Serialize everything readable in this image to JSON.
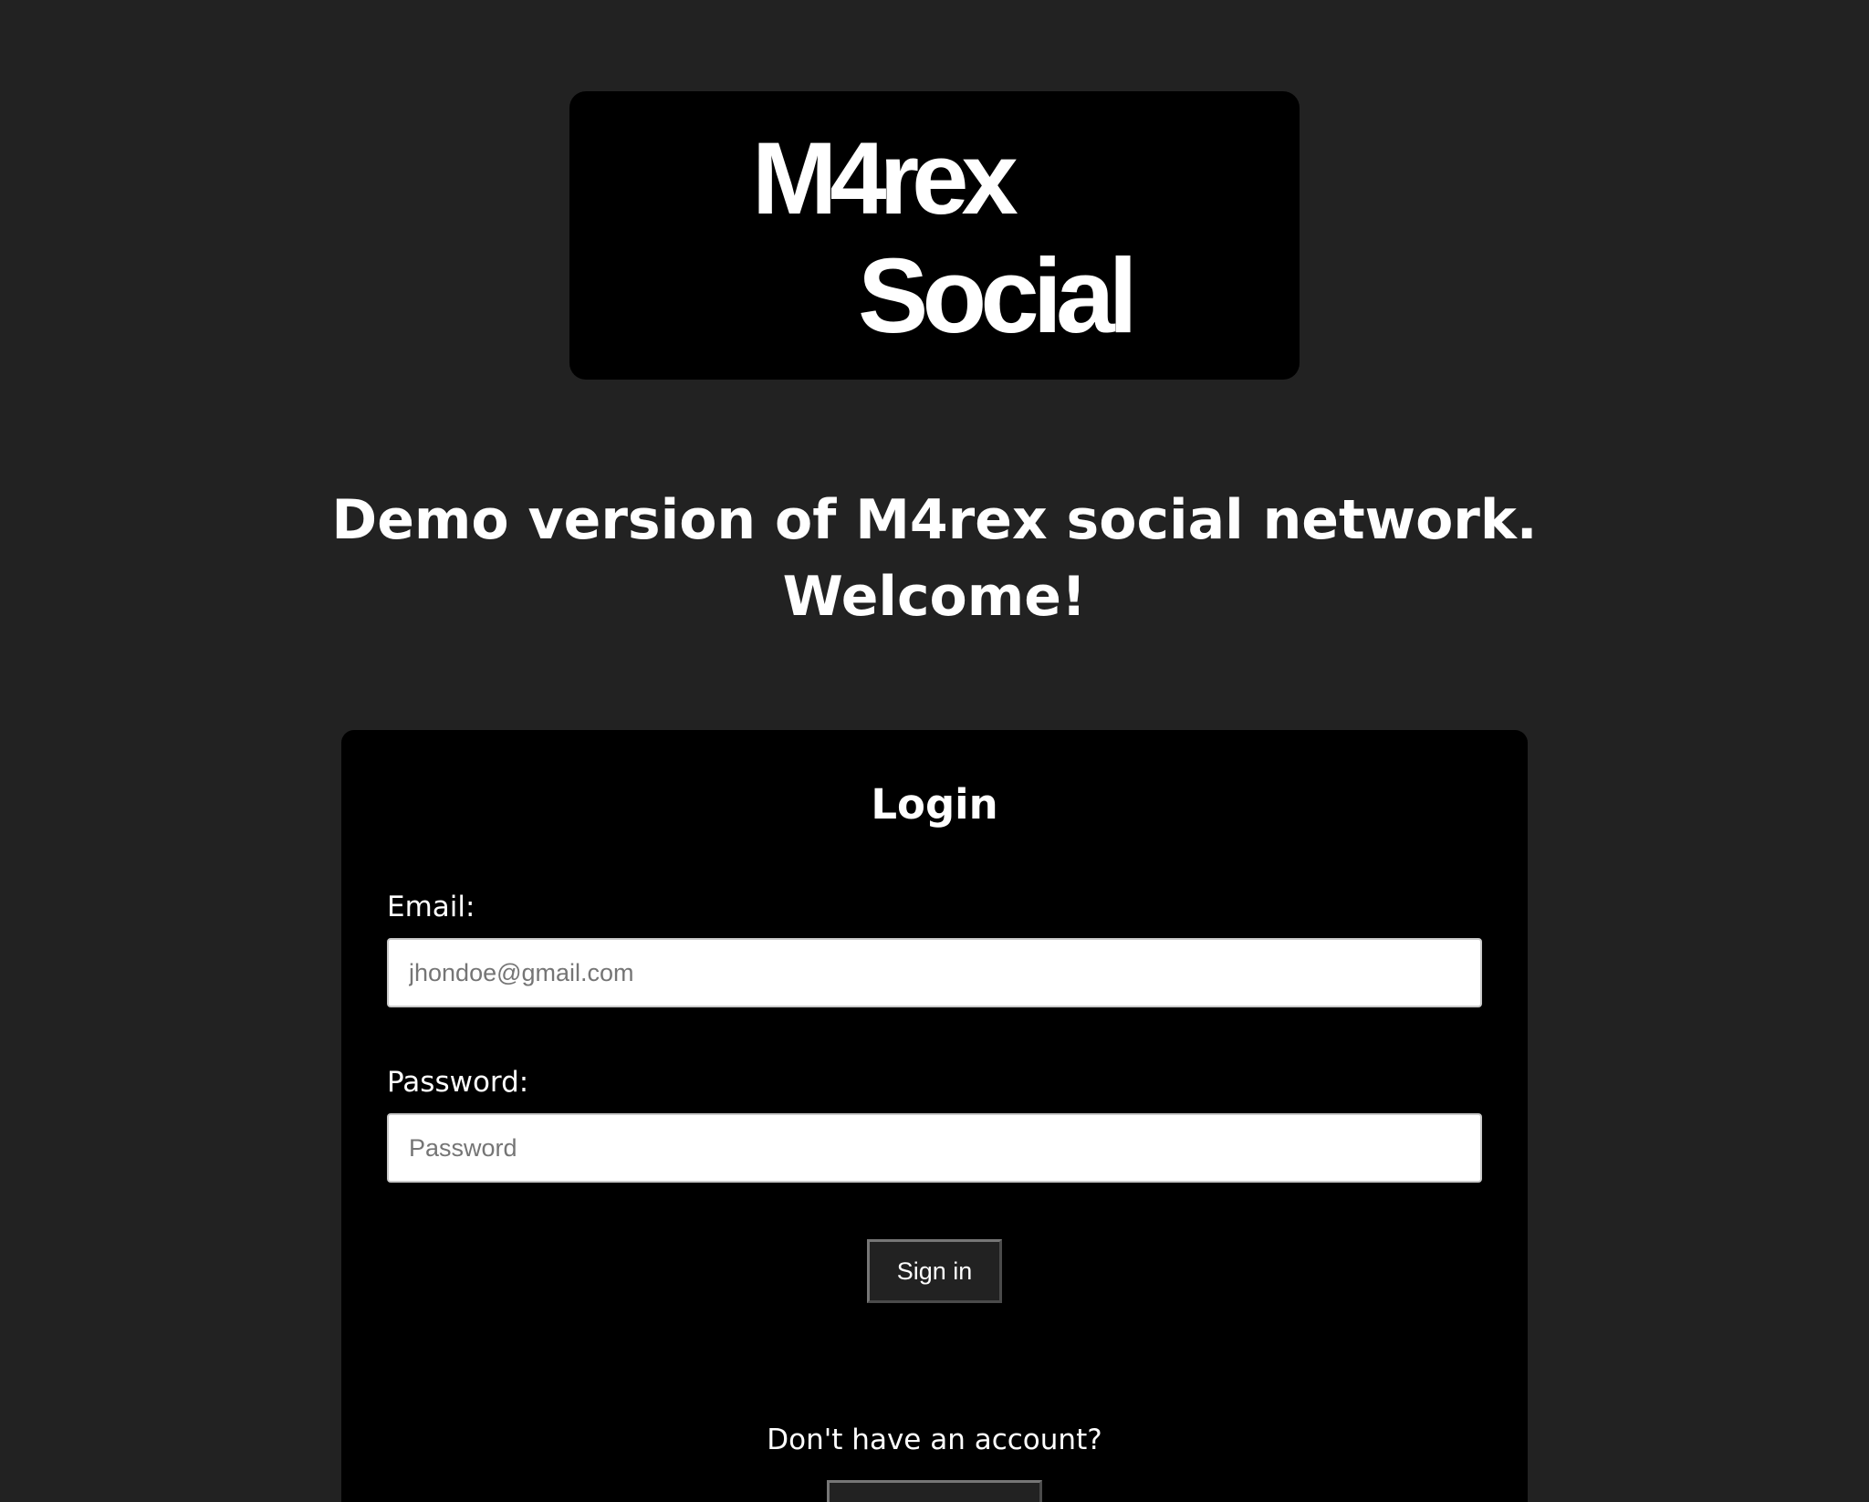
{
  "logo": {
    "line1": "M4rex",
    "line2": "Social"
  },
  "headline": {
    "line1": "Demo version of M4rex social network.",
    "line2": "Welcome!"
  },
  "login": {
    "title": "Login",
    "email_label": "Email:",
    "email_placeholder": "jhondoe@gmail.com",
    "email_value": "",
    "password_label": "Password:",
    "password_placeholder": "Password",
    "password_value": "",
    "signin_label": "Sign in",
    "no_account_text": "Don't have an account?"
  },
  "colors": {
    "page_background": "#222222",
    "card_background": "#000000",
    "text": "#ffffff",
    "button_background": "#222222"
  }
}
